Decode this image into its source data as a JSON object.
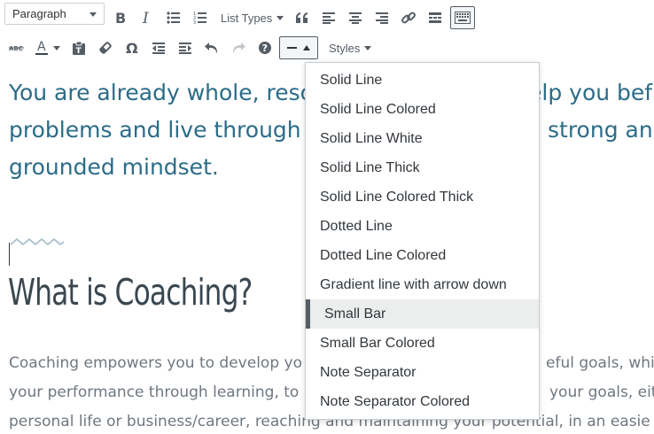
{
  "toolbar": {
    "format_select": "Paragraph",
    "list_types_label": "List Types",
    "styles_label": "Styles",
    "icons": {
      "row1": [
        "bold-icon",
        "italic-icon",
        "bullet-list-icon",
        "numbered-list-icon",
        "list-types-dropdown",
        "blockquote-icon",
        "align-left-icon",
        "align-center-icon",
        "align-right-icon",
        "link-icon",
        "read-more-icon",
        "toolbar-toggle-icon"
      ],
      "row2": [
        "strikethrough-icon",
        "text-color-icon",
        "paste-as-text-icon",
        "clear-formatting-icon",
        "special-character-icon",
        "outdent-icon",
        "indent-icon",
        "undo-icon",
        "redo-icon",
        "help-icon",
        "horizontal-line-dropdown",
        "styles-dropdown"
      ]
    }
  },
  "content": {
    "lead_lines": [
      "You are already whole, reso",
      "problems and live through t",
      "grounded mindset."
    ],
    "lead_lines_right": [
      "elp you bef",
      "strong and"
    ],
    "heading": "What is Coaching?",
    "body_lines": [
      "Coaching empowers you to develop yo",
      "your performance through learning, to",
      "personal life or business/career, reaching and maintaining your potential, in an easie"
    ],
    "body_lines_right": [
      "eful goals, whil",
      "your goals, eithe"
    ]
  },
  "dropdown": {
    "items": [
      "Solid Line",
      "Solid Line Colored",
      "Solid Line White",
      "Solid Line Thick",
      "Solid Line Colored Thick",
      "Dotted Line",
      "Dotted Line Colored",
      "Gradient line with arrow down",
      "Small Bar",
      "Small Bar Colored",
      "Note Separator",
      "Note Separator Colored"
    ],
    "selected": "Small Bar"
  },
  "colors": {
    "accent_text": "#2b6c88",
    "heading": "#3a4750",
    "icon": "#555d66"
  }
}
